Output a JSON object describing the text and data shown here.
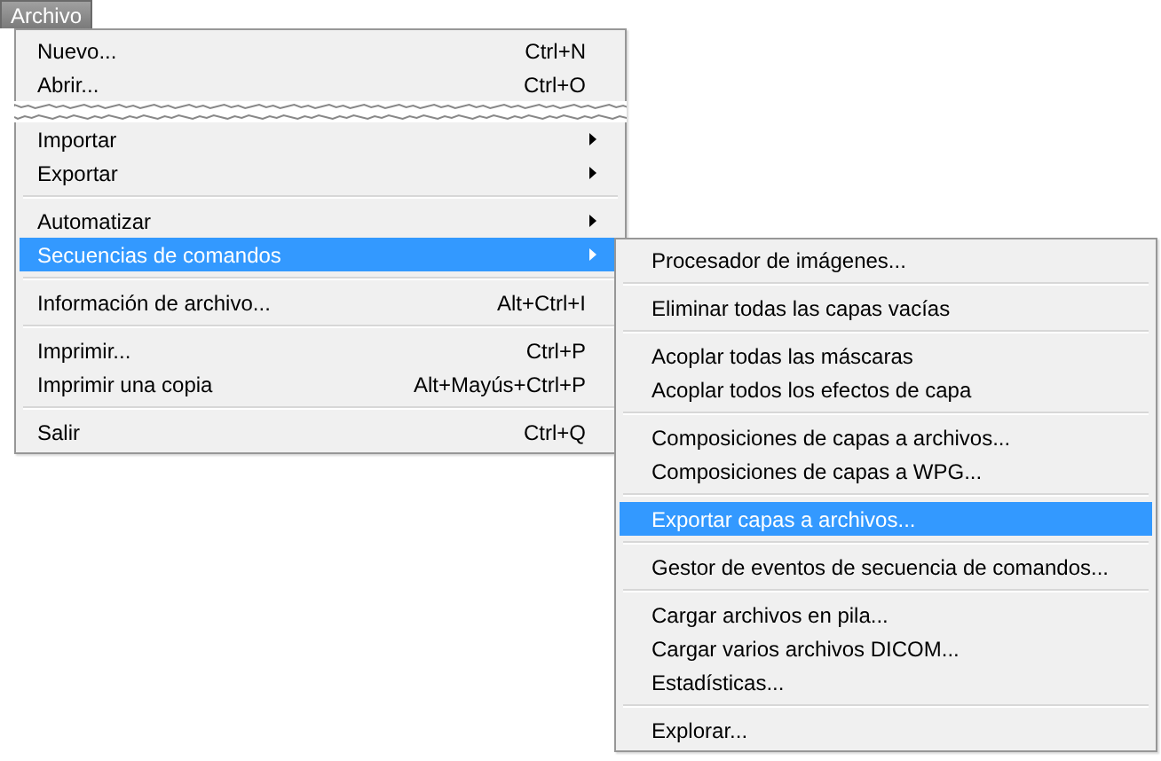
{
  "menu_bar": {
    "label": "Archivo",
    "selected": true
  },
  "menu": {
    "items": [
      {
        "kind": "item",
        "label": "Nuevo...",
        "shortcut": "Ctrl+N",
        "submenu": false,
        "selected": false
      },
      {
        "kind": "item",
        "label": "Abrir...",
        "shortcut": "Ctrl+O",
        "submenu": false,
        "selected": false
      },
      {
        "kind": "tear"
      },
      {
        "kind": "item",
        "label": "Importar",
        "submenu": true,
        "selected": false
      },
      {
        "kind": "item",
        "label": "Exportar",
        "submenu": true,
        "selected": false
      },
      {
        "kind": "separator"
      },
      {
        "kind": "item",
        "label": "Automatizar",
        "submenu": true,
        "selected": false
      },
      {
        "kind": "item",
        "label": "Secuencias de comandos",
        "submenu": true,
        "selected": true
      },
      {
        "kind": "separator"
      },
      {
        "kind": "item",
        "label": "Información de archivo...",
        "shortcut": "Alt+Ctrl+I",
        "submenu": false,
        "selected": false
      },
      {
        "kind": "separator"
      },
      {
        "kind": "item",
        "label": "Imprimir...",
        "shortcut": "Ctrl+P",
        "submenu": false,
        "selected": false
      },
      {
        "kind": "item",
        "label": "Imprimir una copia",
        "shortcut": "Alt+Mayús+Ctrl+P",
        "submenu": false,
        "selected": false
      },
      {
        "kind": "separator"
      },
      {
        "kind": "item",
        "label": "Salir",
        "shortcut": "Ctrl+Q",
        "submenu": false,
        "selected": false
      }
    ]
  },
  "submenu": {
    "items": [
      {
        "kind": "item",
        "label": "Procesador de imágenes...",
        "selected": false
      },
      {
        "kind": "separator"
      },
      {
        "kind": "item",
        "label": "Eliminar todas las capas vacías",
        "selected": false
      },
      {
        "kind": "separator"
      },
      {
        "kind": "item",
        "label": "Acoplar todas las máscaras",
        "selected": false
      },
      {
        "kind": "item",
        "label": "Acoplar todos los efectos de capa",
        "selected": false
      },
      {
        "kind": "separator"
      },
      {
        "kind": "item",
        "label": "Composiciones de capas a archivos...",
        "selected": false
      },
      {
        "kind": "item",
        "label": "Composiciones de capas a WPG...",
        "selected": false
      },
      {
        "kind": "separator"
      },
      {
        "kind": "item",
        "label": "Exportar capas a archivos...",
        "selected": true
      },
      {
        "kind": "separator"
      },
      {
        "kind": "item",
        "label": "Gestor de eventos de secuencia de comandos...",
        "selected": false
      },
      {
        "kind": "separator"
      },
      {
        "kind": "item",
        "label": "Cargar archivos en pila...",
        "selected": false
      },
      {
        "kind": "item",
        "label": "Cargar varios archivos DICOM...",
        "selected": false
      },
      {
        "kind": "item",
        "label": "Estadísticas...",
        "selected": false
      },
      {
        "kind": "separator"
      },
      {
        "kind": "item",
        "label": "Explorar...",
        "selected": false
      }
    ]
  }
}
